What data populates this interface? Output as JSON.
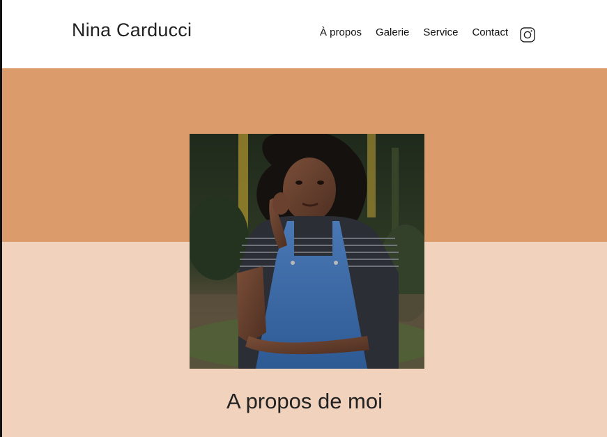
{
  "header": {
    "title": "Nina Carducci",
    "nav": [
      {
        "label": "À propos"
      },
      {
        "label": "Galerie"
      },
      {
        "label": "Service"
      },
      {
        "label": "Contact"
      }
    ],
    "social_icon": "instagram-icon"
  },
  "hero": {
    "top_color": "#db9b6a",
    "bottom_color": "#f1d3bd",
    "photo_icon": "portrait-photo"
  },
  "about": {
    "title": "A propos de moi"
  }
}
